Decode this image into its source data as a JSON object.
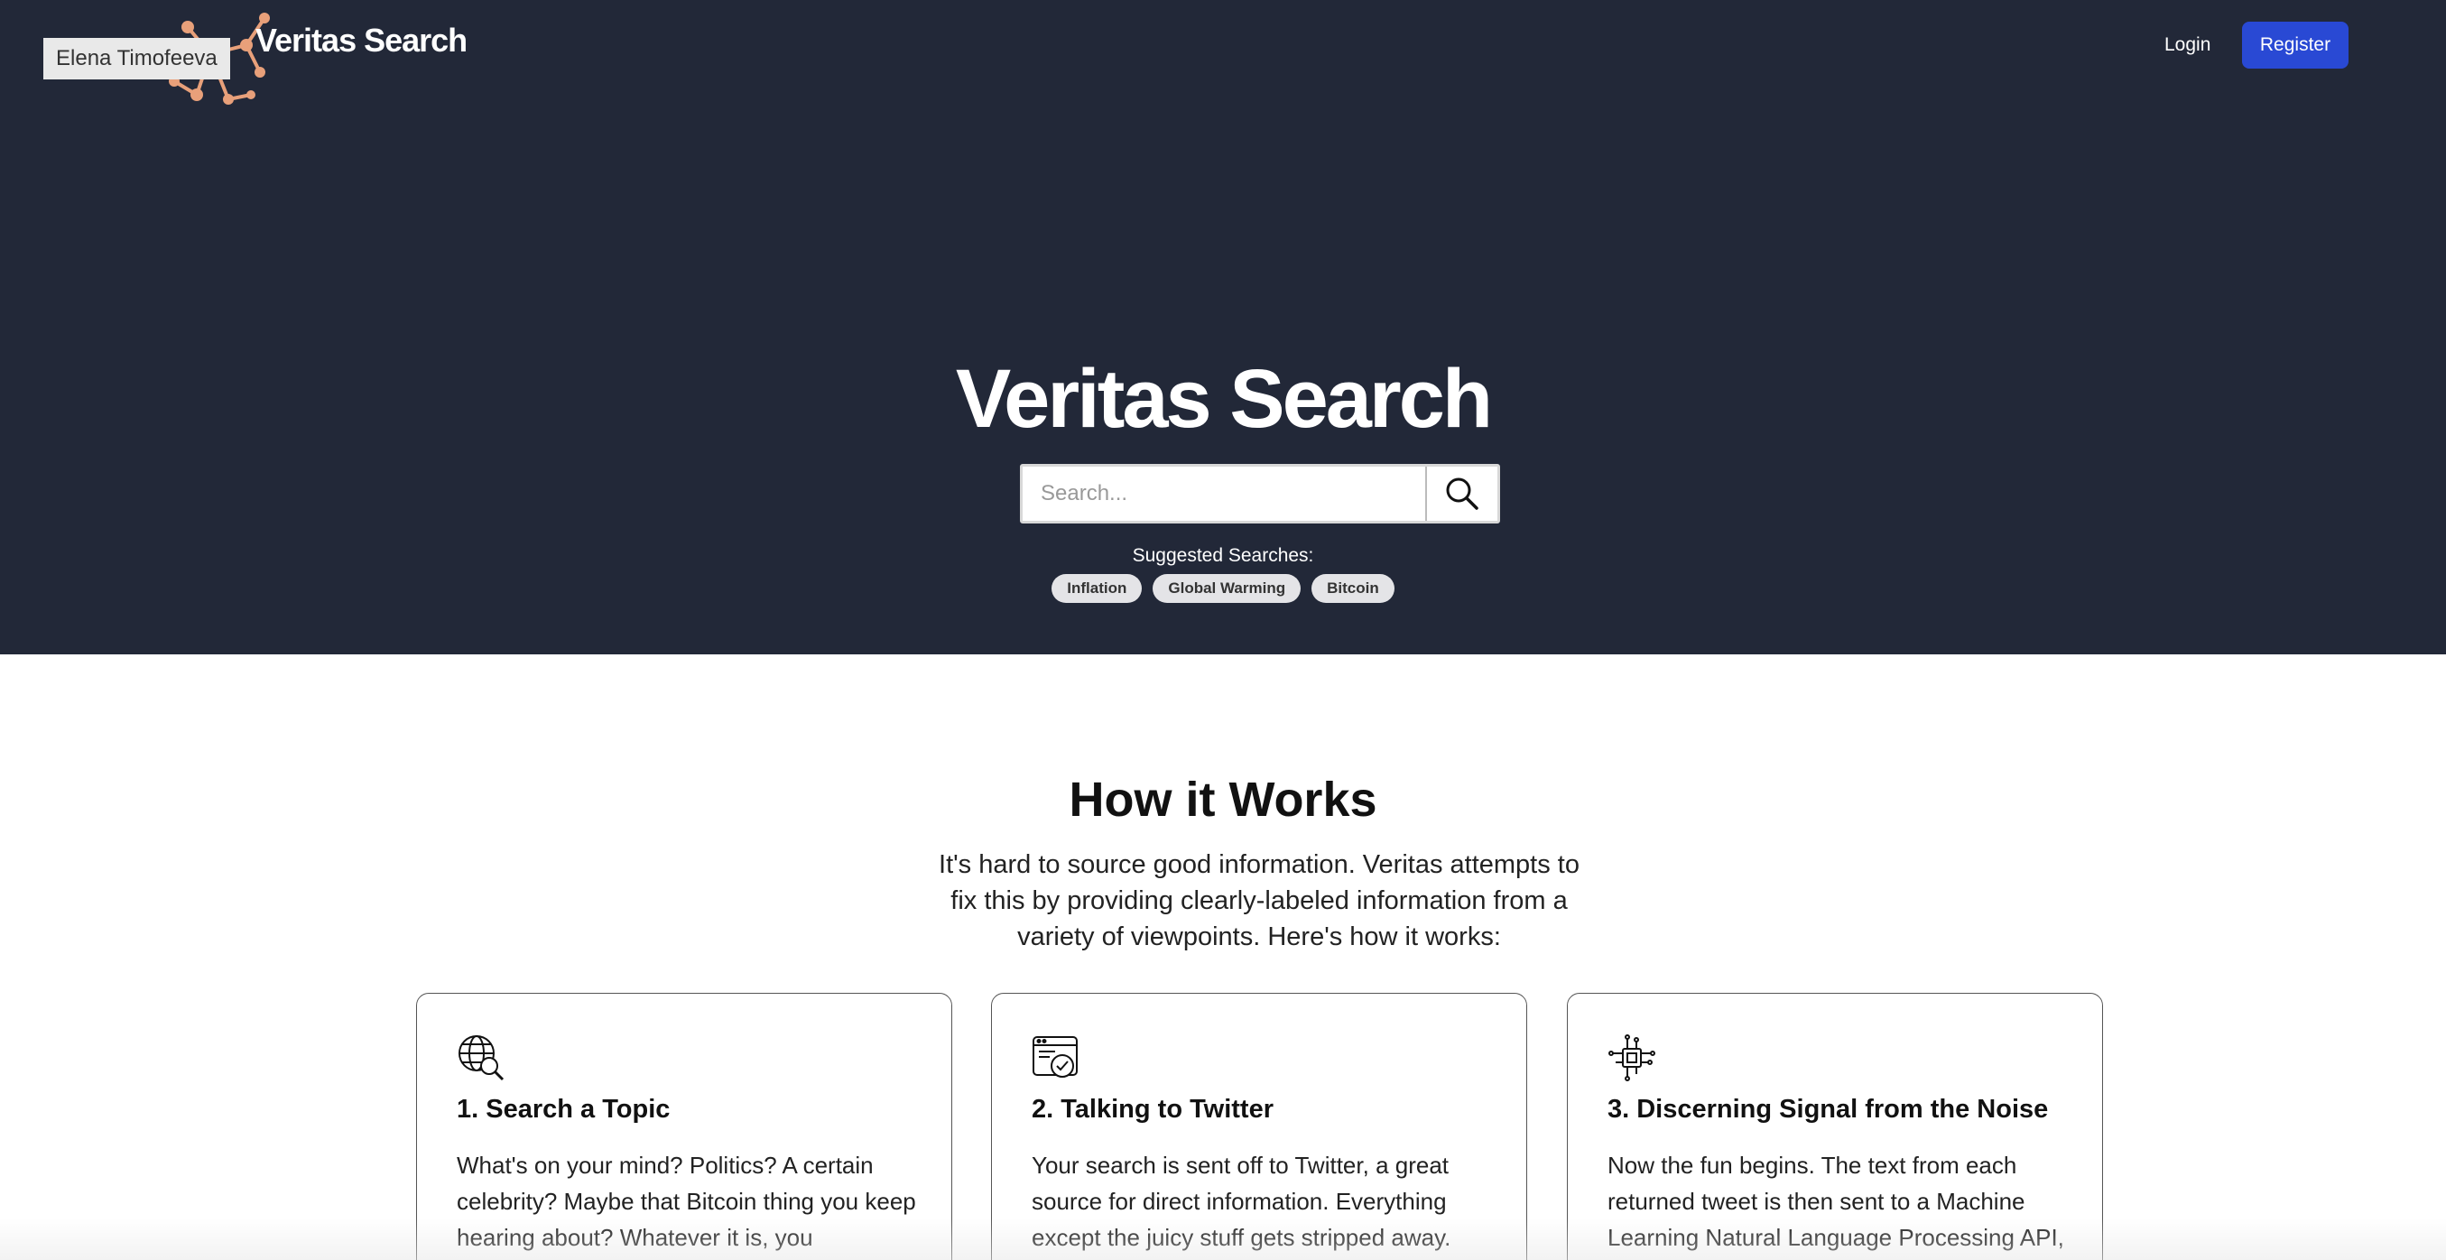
{
  "header": {
    "user_name": "Elena Timofeeva",
    "brand": "Veritas Search",
    "login_label": "Login",
    "register_label": "Register"
  },
  "hero": {
    "title": "Veritas Search",
    "search_placeholder": "Search...",
    "search_value": "",
    "suggested_label": "Suggested Searches:",
    "suggestions": [
      "Inflation",
      "Global Warming",
      "Bitcoin"
    ]
  },
  "how": {
    "title": "How it Works",
    "description": "It's hard to source good information. Veritas attempts to fix this by providing clearly-labeled information from a variety of viewpoints. Here's how it works:",
    "cards": [
      {
        "icon": "globe-search-icon",
        "title": "1. Search a Topic",
        "body": "What's on your mind? Politics? A certain celebrity? Maybe that Bitcoin thing you keep hearing about? Whatever it is, you"
      },
      {
        "icon": "twitter-browser-icon",
        "title": "2. Talking to Twitter",
        "body": "Your search is sent off to Twitter, a great source for direct information. Everything except the juicy stuff gets stripped away."
      },
      {
        "icon": "circuit-chip-icon",
        "title": "3. Discerning Signal from the Noise",
        "body": "Now the fun begins. The text from each returned tweet is then sent to a Machine Learning Natural Language Processing API,"
      }
    ]
  },
  "colors": {
    "hero_bg": "#222838",
    "register_bg": "#2949d4",
    "logo_accent": "#e8a07a"
  }
}
